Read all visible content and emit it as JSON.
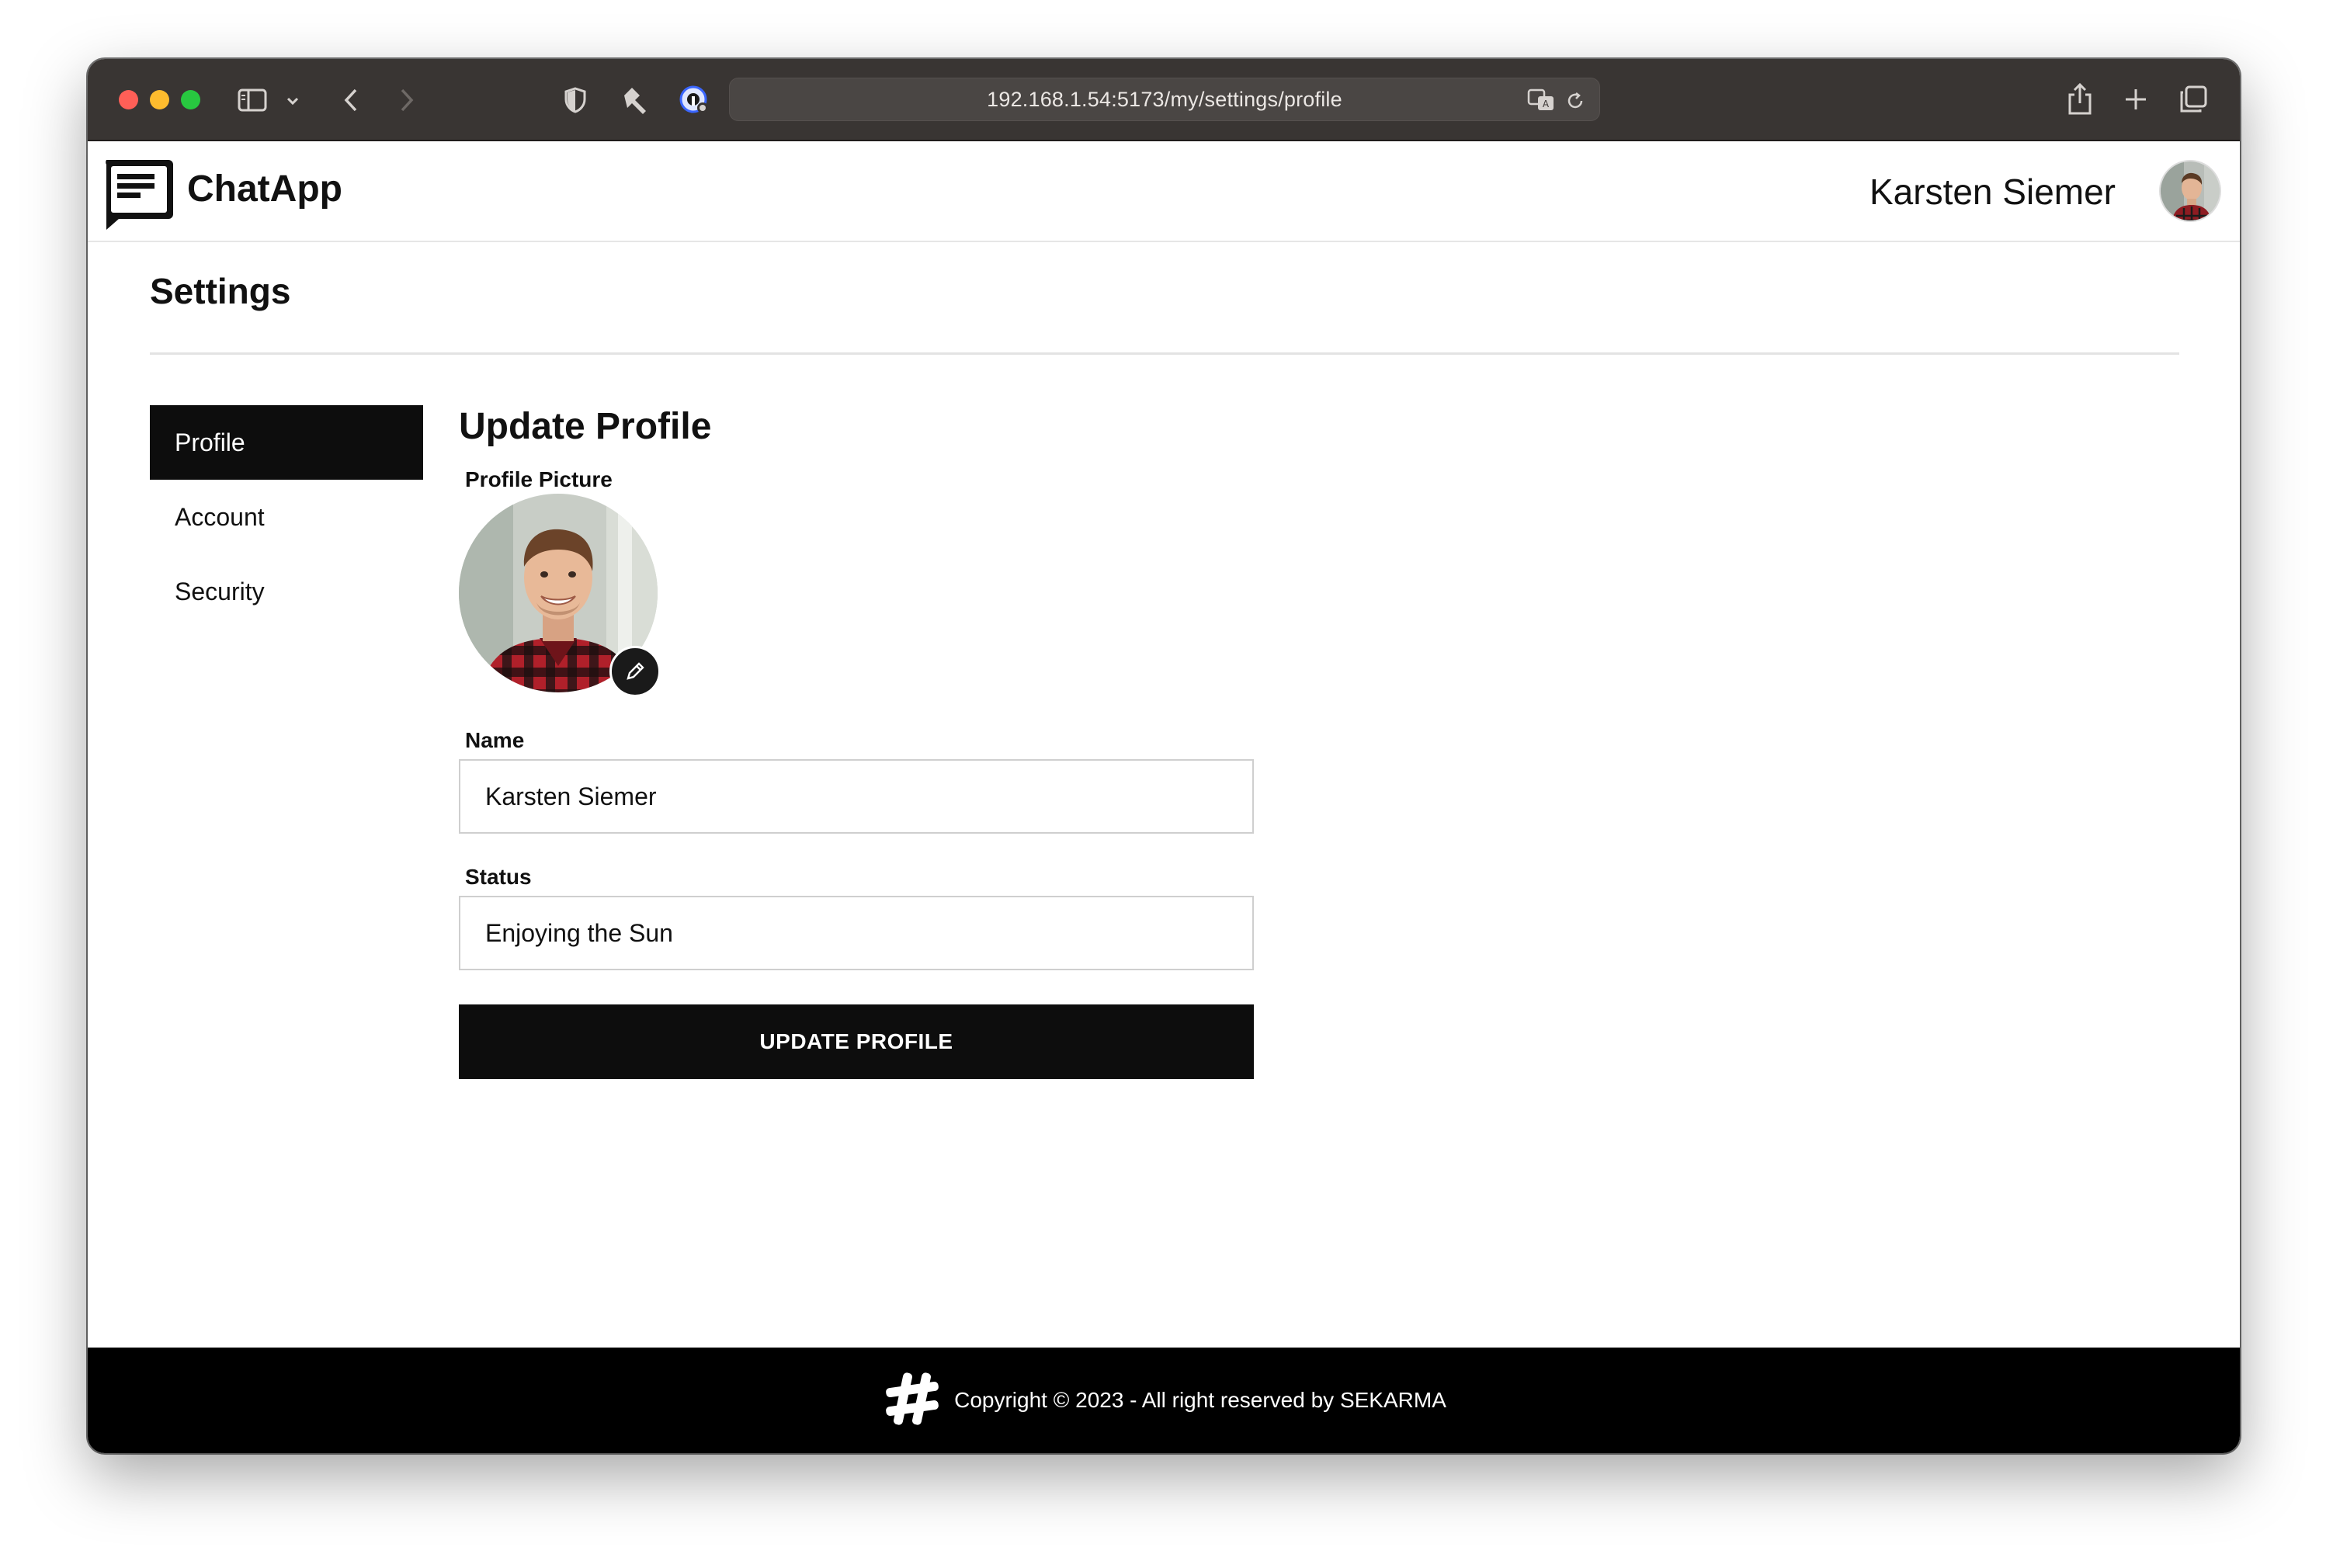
{
  "browser": {
    "url": "192.168.1.54:5173/my/settings/profile"
  },
  "header": {
    "brand": "ChatApp",
    "user_name": "Karsten Siemer"
  },
  "page": {
    "title": "Settings"
  },
  "sidebar": {
    "items": [
      {
        "label": "Profile",
        "active": true
      },
      {
        "label": "Account",
        "active": false
      },
      {
        "label": "Security",
        "active": false
      }
    ]
  },
  "form": {
    "title": "Update Profile",
    "picture_label": "Profile Picture",
    "name_label": "Name",
    "name_value": "Karsten Siemer",
    "status_label": "Status",
    "status_value": "Enjoying the Sun",
    "submit_label": "UPDATE PROFILE"
  },
  "footer": {
    "text": "Copyright © 2023 - All right reserved by SEKARMA"
  },
  "colors": {
    "toolbar": "#393533",
    "primary": "#0d0d0d",
    "footer": "#000000"
  }
}
